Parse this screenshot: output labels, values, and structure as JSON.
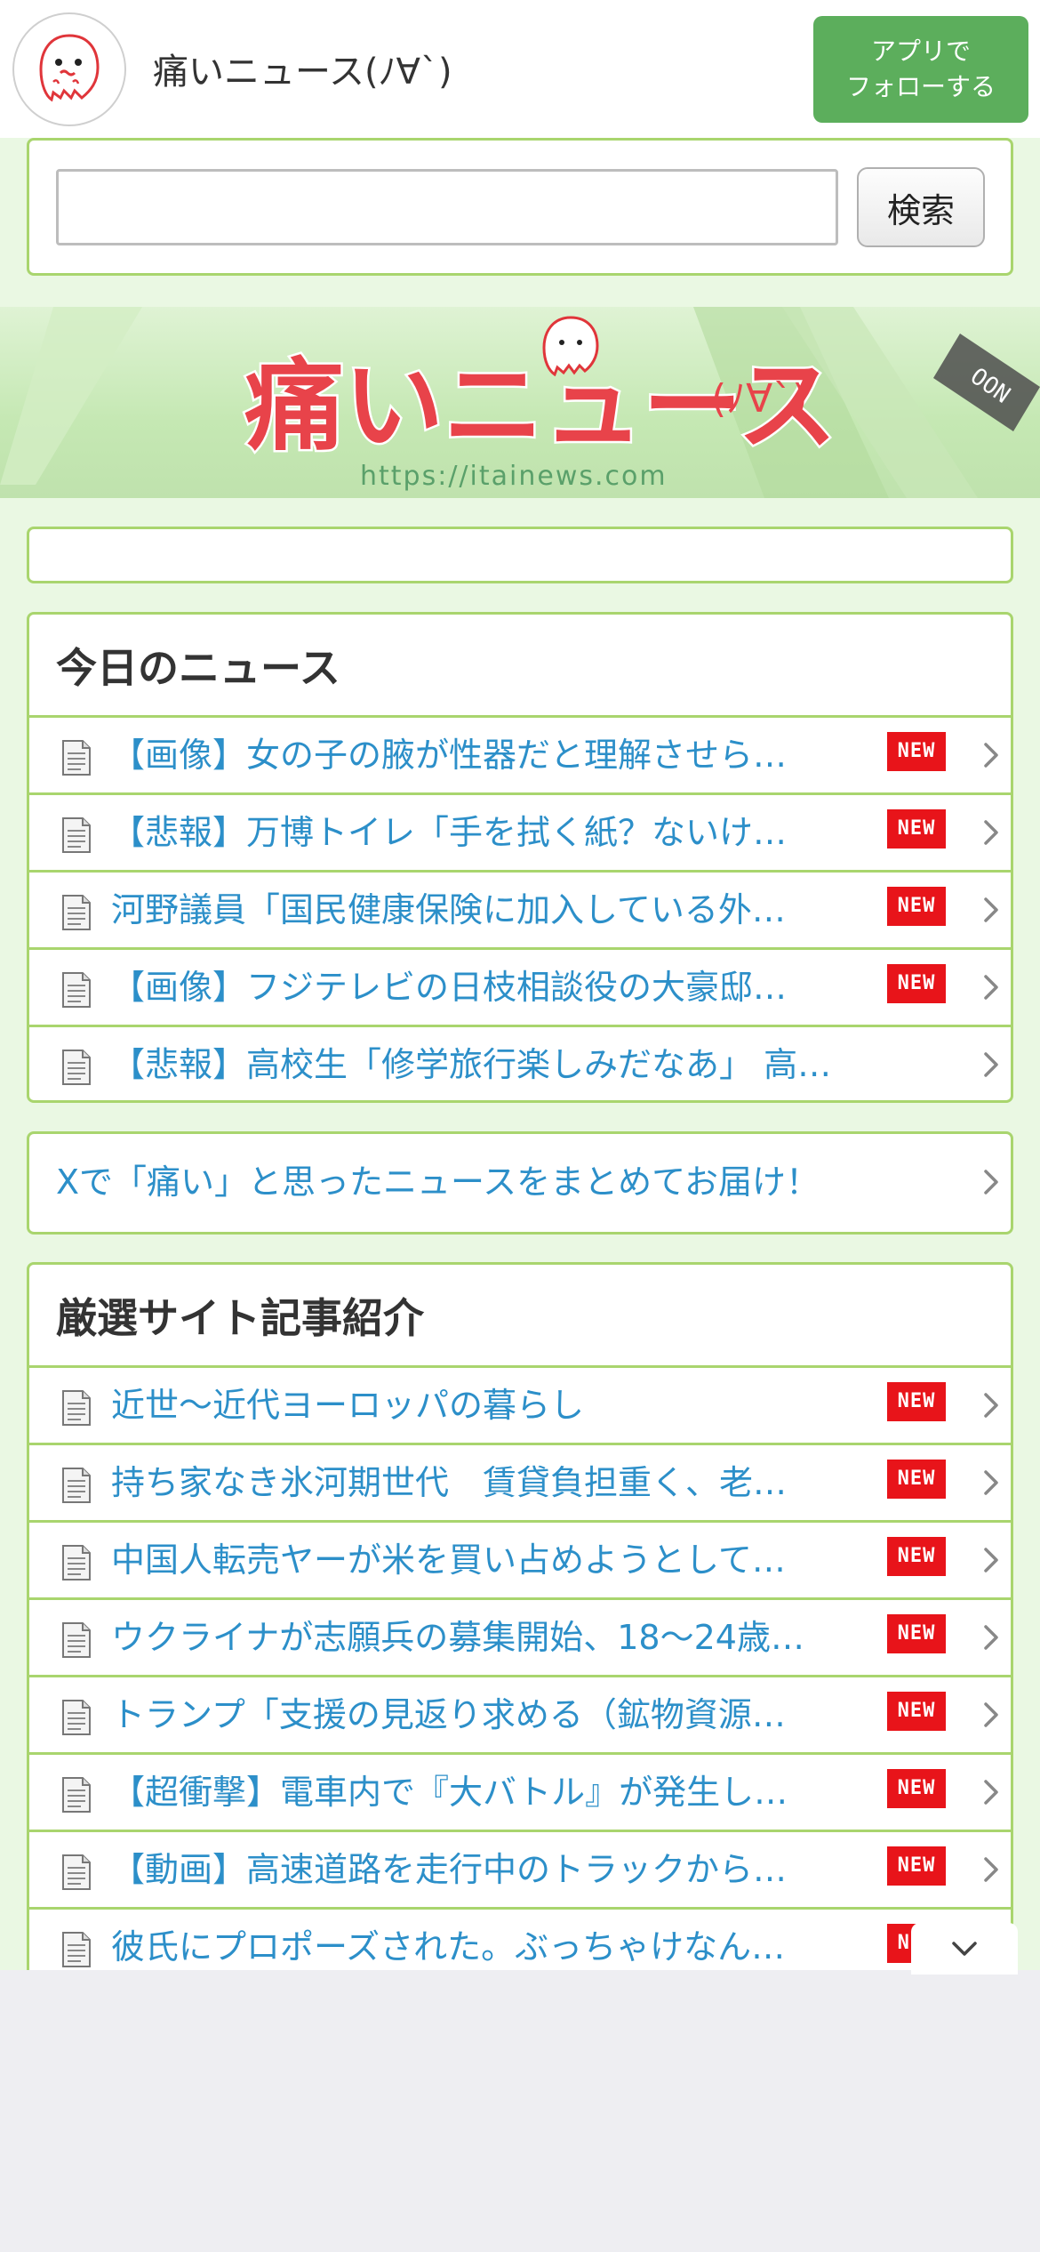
{
  "header": {
    "site_title": "痛いニュース(ﾉ∀`)",
    "follow_button_line1": "アプリで",
    "follow_button_line2": "フォローする"
  },
  "search": {
    "input_value": "",
    "button_label": "検索"
  },
  "banner": {
    "title": "痛いニュース",
    "kaomoji": "(ﾉ∀`)",
    "url": "https://itainews.com",
    "badge": "OON"
  },
  "today_news": {
    "title": "今日のニュース",
    "items": [
      {
        "text": "【画像】女の子の腋が性器だと理解させら…",
        "new": "NEW"
      },
      {
        "text": "【悲報】万博トイレ「手を拭く紙？ないけ…",
        "new": "NEW"
      },
      {
        "text": "河野議員「国民健康保険に加入している外…",
        "new": "NEW"
      },
      {
        "text": "【画像】フジテレビの日枝相談役の大豪邸…",
        "new": "NEW"
      },
      {
        "text": "【悲報】高校生「修学旅行楽しみだなあ」 高…",
        "new": ""
      }
    ]
  },
  "promo": {
    "text": "Xで「痛い」と思ったニュースをまとめてお届け！"
  },
  "picked_sites": {
    "title": "厳選サイト記事紹介",
    "items": [
      {
        "text": "近世〜近代ヨーロッパの暮らし",
        "new": "NEW"
      },
      {
        "text": "持ち家なき氷河期世代　賃貸負担重く、老…",
        "new": "NEW"
      },
      {
        "text": "中国人転売ヤーが米を買い占めようとして…",
        "new": "NEW"
      },
      {
        "text": "ウクライナが志願兵の募集開始、18〜24歳…",
        "new": "NEW"
      },
      {
        "text": "トランプ「支援の見返り求める（鉱物資源…",
        "new": "NEW"
      },
      {
        "text": "【超衝撃】電車内で『大バトル』が発生し…",
        "new": "NEW"
      },
      {
        "text": "【動画】高速道路を走行中のトラックから…",
        "new": "NEW"
      },
      {
        "text": "彼氏にプロポーズされた。ぶっちゃけなん…",
        "new": "NEW"
      }
    ]
  },
  "icons": {
    "logo": "ghost-mascot-icon",
    "row": "document-icon",
    "chevron": "chevron-right-icon",
    "scroll": "chevron-down-icon"
  },
  "colors": {
    "accent_green": "#5cae5c",
    "border_green": "#a9d56e",
    "link_blue": "#2c8fc9",
    "new_red": "#e8141a"
  }
}
